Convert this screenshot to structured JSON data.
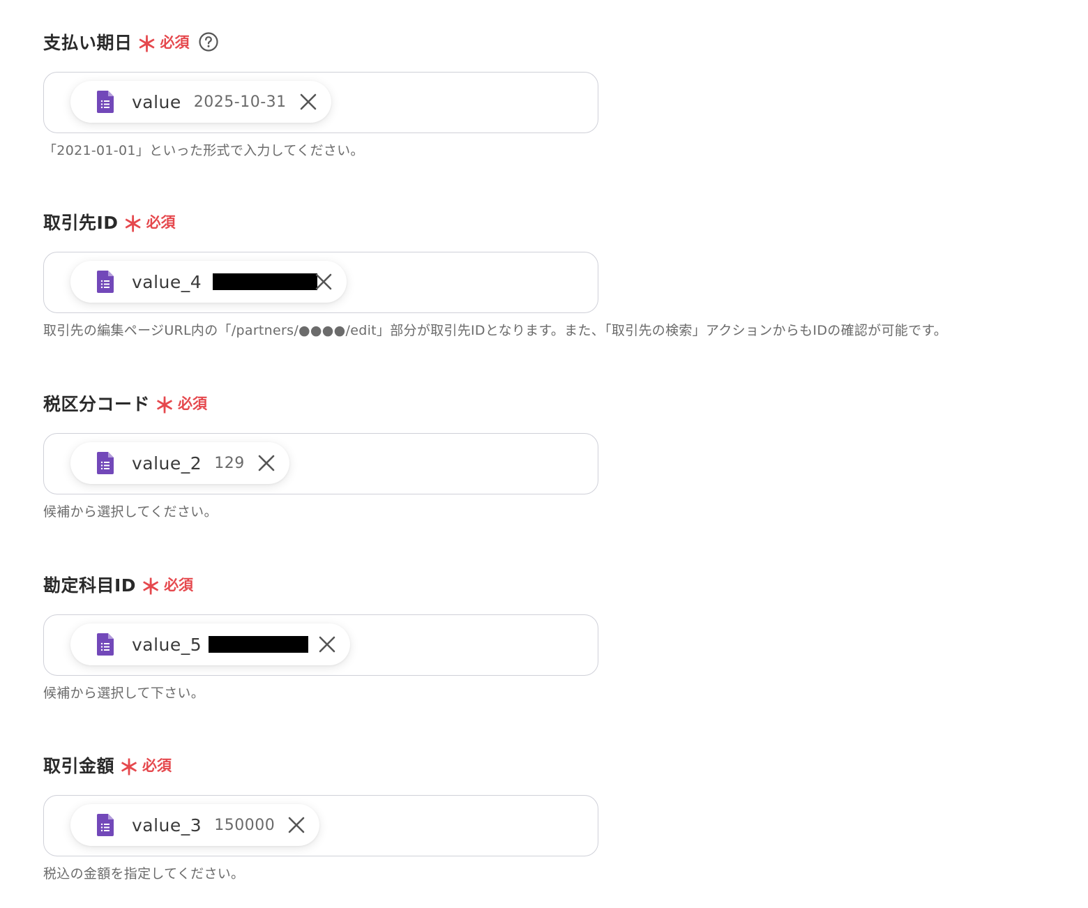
{
  "required_mark": "＊",
  "required_text": "必須",
  "fields": [
    {
      "label": "支払い期日",
      "chip_name": "value",
      "chip_value": "2025-10-31",
      "hint": "「2021-01-01」といった形式で入力してください。"
    },
    {
      "label": "取引先ID",
      "chip_name": "value_4",
      "chip_value": "",
      "hint": "取引先の編集ページURL内の「/partners/●●●●/edit」部分が取引先IDとなります。また、「取引先の検索」アクションからもIDの確認が可能です。"
    },
    {
      "label": "税区分コード",
      "chip_name": "value_2",
      "chip_value": "129",
      "hint": "候補から選択してください。"
    },
    {
      "label": "勘定科目ID",
      "chip_name": "value_5",
      "chip_value": "",
      "hint": "候補から選択して下さい。"
    },
    {
      "label": "取引金額",
      "chip_name": "value_3",
      "chip_value": "150000",
      "hint": "税込の金額を指定してください。"
    }
  ],
  "icons": {
    "help": "question-circle-icon",
    "chip": "google-forms-doc-icon",
    "remove": "close-icon"
  },
  "colors": {
    "required": "#e5484d",
    "chip_icon": "#7248b9",
    "border": "#cfd0d8"
  }
}
